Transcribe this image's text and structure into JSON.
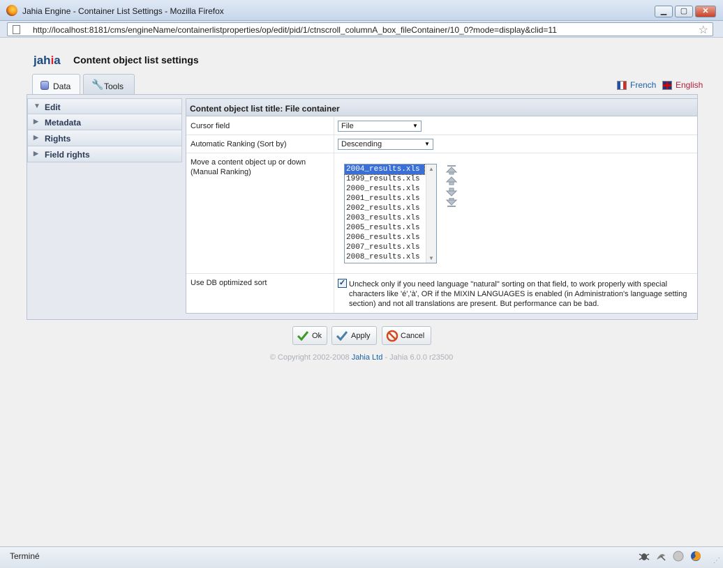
{
  "window": {
    "title": "Jahia Engine - Container List Settings - Mozilla Firefox"
  },
  "address": {
    "url": "http://localhost:8181/cms/engineName/containerlistproperties/op/edit/pid/1/ctnscroll_columnA_box_fileContainer/10_0?mode=display&clid=11"
  },
  "header": {
    "logo": "jahia",
    "title": "Content object list settings"
  },
  "tabs": [
    {
      "label": "Data",
      "icon": "database-icon",
      "active": true
    },
    {
      "label": "Tools",
      "icon": "wrench-icon",
      "active": false
    }
  ],
  "languages": [
    {
      "label": "French",
      "icon": "flag-fr-icon"
    },
    {
      "label": "English",
      "icon": "flag-en-icon"
    }
  ],
  "sidebar": {
    "items": [
      {
        "label": "Edit",
        "expanded": true
      },
      {
        "label": "Metadata",
        "expanded": false
      },
      {
        "label": "Rights",
        "expanded": false
      },
      {
        "label": "Field rights",
        "expanded": false
      }
    ]
  },
  "panel": {
    "title": "Content object list title: File container",
    "cursor_field": {
      "label": "Cursor field",
      "value": "File"
    },
    "ranking": {
      "label": "Automatic Ranking (Sort by)",
      "value": "Descending"
    },
    "manual": {
      "label_line1": "Move a content object up or down",
      "label_line2": "(Manual Ranking)",
      "items": [
        "2004_results.xls",
        "1999_results.xls",
        "2000_results.xls",
        "2001_results.xls",
        "2002_results.xls",
        "2003_results.xls",
        "2005_results.xls",
        "2006_results.xls",
        "2007_results.xls",
        "2008_results.xls"
      ],
      "selected": "2004_results.xls"
    },
    "db_sort": {
      "label": "Use DB optimized sort",
      "checked": true,
      "text": "Uncheck only if you need language \"natural\" sorting on that field, to work properly with special characters like 'é','à', OR if the MIXIN LANGUAGES is enabled (in Administration's language setting section) and not all translations are present. But performance can be bad."
    }
  },
  "buttons": {
    "ok": "Ok",
    "apply": "Apply",
    "cancel": "Cancel"
  },
  "footer": {
    "copyright_prefix": "© Copyright 2002-2008",
    "company": "Jahia Ltd",
    "version_suffix": "- Jahia 6.0.0 r23500"
  },
  "statusbar": {
    "text": "Terminé"
  }
}
